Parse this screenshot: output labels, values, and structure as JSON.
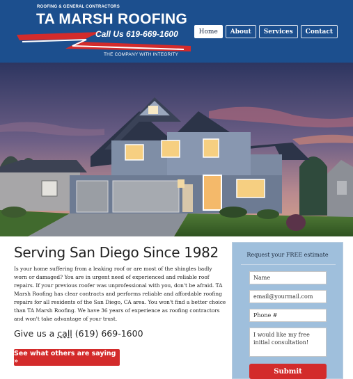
{
  "header": {
    "logo": {
      "small_text": "ROOFING & GENERAL CONTRACTORS",
      "company_name": "TA MARSH ROOFING",
      "phone_text": "Call Us 619-669-1600",
      "tagline": "THE COMPANY WITH INTEGRITY"
    },
    "nav": [
      {
        "label": "Home"
      },
      {
        "label": "About"
      },
      {
        "label": "Services"
      },
      {
        "label": "Contact"
      }
    ]
  },
  "main": {
    "headline": "Serving San Diego Since 1982",
    "body": "Is your home suffering from a leaking roof or are most of the shingles badly worn or damaged? You are in urgent need of experienced and reliable roof repairs. If your previous roofer was unprofessional with you, don't be afraid. TA Marsh Roofing has clear contracts and performs reliable and affordable roofing repairs for all residents of the San Diego, CA area. You won't find a better choice than TA Marsh Roofing. We have 36 years of experience as roofing contractors and won't take advantage of your trust.",
    "call_prefix": "Give us a",
    "call_link": "call",
    "call_phone": "(619) 669-1600",
    "cta_label": "See what others are saying »"
  },
  "form": {
    "title": "Request your FREE estimate",
    "name_value": "Name",
    "email_value": "email@yourmail.com",
    "phone_value": "Phone #",
    "message_value": "I would like my free initial consultation!",
    "submit_label": "Submit"
  },
  "colors": {
    "header_bg": "#1c4f8e",
    "accent_red": "#d32b2b",
    "form_bg": "#9fbfdc"
  }
}
